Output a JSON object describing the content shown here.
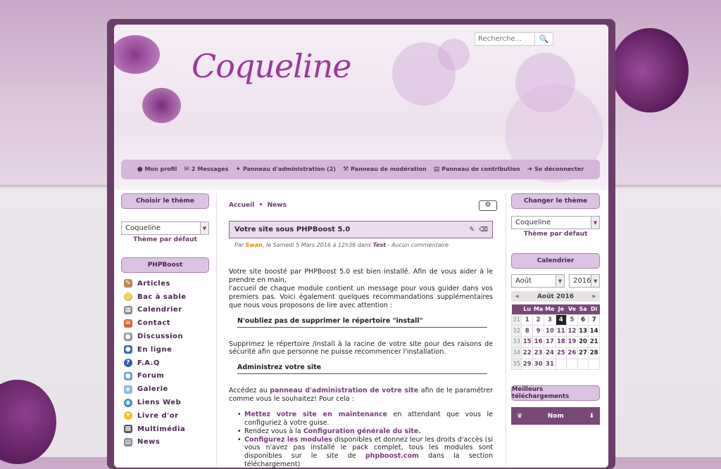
{
  "search": {
    "placeholder": "Recherche..."
  },
  "logo": "Coqueline",
  "menu": [
    {
      "icon": "user-icon",
      "label": "Mon profil"
    },
    {
      "icon": "envelope-icon",
      "label": "2 Messages"
    },
    {
      "icon": "wrench-icon",
      "label": "Panneau d'administration (2)"
    },
    {
      "icon": "gavel-icon",
      "label": "Panneau de modération"
    },
    {
      "icon": "file-icon",
      "label": "Panneau de contribution"
    },
    {
      "icon": "sign-out-icon",
      "label": "Se déconnecter"
    }
  ],
  "left": {
    "theme_title": "Choisir le thème",
    "theme_value": "Coqueline",
    "theme_default": "Thème par défaut",
    "menu_title": "PHPBoost",
    "modules": [
      "Articles",
      "Bac à sable",
      "Calendrier",
      "Contact",
      "Discussion",
      "En ligne",
      "F.A.Q",
      "Forum",
      "Galerie",
      "Liens Web",
      "Livre d'or",
      "Multimédia",
      "News"
    ]
  },
  "main": {
    "breadcrumb": [
      "Accueil",
      "News"
    ],
    "title": "Votre site sous PHPBoost 5.0",
    "byline": {
      "par": "Par",
      "user": "Swan",
      "date": ", le Samedi 5 Mars 2016 à 12h36 dans",
      "cat": "Test",
      "comments": "- Aucun commentaire"
    },
    "p1": "Votre site boosté par PHPBoost 5.0 est bien installé. Afin de vous aider à le prendre en main,",
    "p1b": "l'accueil de chaque module contient un message pour vous guider dans vos premiers pas. Voici également quelques recommandations supplémentaires que nous vous proposons de lire avec attention :",
    "h1": "N'oubliez pas de supprimer le répertoire \"install\"",
    "p2": "Supprimez le répertoire /install à la racine de votre site pour des raisons de sécurité afin que personne ne puisse recommencer l'installation.",
    "h2": "Administrez votre site",
    "p3a": "Accédez au",
    "p3link": "panneau d'administration de votre site",
    "p3b": "afin de le paramétrer comme vous le souhaitez! Pour cela :",
    "b1link": "Mettez votre site en maintenance",
    "b1": "en attendant que vous le configuriez à votre guise.",
    "b2a": "Rendez vous à la",
    "b2link": "Configuration générale du site.",
    "b3link": "Configurez les modules",
    "b3": "disponibles et donnez leur les droits d'accès (si vous n'avez pas installé le pack complet, tous les modules sont disponibles sur le site de",
    "b3link2": "phpboost.com",
    "b3c": "dans la section téléchargement)"
  },
  "right": {
    "theme_title": "Changer le thème",
    "theme_value": "Coqueline",
    "theme_default": "Thème par défaut",
    "cal_title": "Calendrier",
    "month": "Août",
    "year": "2016",
    "cal_label": "Août 2016",
    "days": [
      "Lu",
      "Ma",
      "Me",
      "Je",
      "Ve",
      "Sa",
      "Di"
    ],
    "weeks": [
      [
        "31",
        "1",
        "2",
        "3",
        "4",
        "5",
        "6",
        "7"
      ],
      [
        "32",
        "8",
        "9",
        "10",
        "11",
        "12",
        "13",
        "14"
      ],
      [
        "33",
        "15",
        "16",
        "17",
        "18",
        "19",
        "20",
        "21"
      ],
      [
        "34",
        "22",
        "23",
        "24",
        "25",
        "26",
        "27",
        "28"
      ],
      [
        "35",
        "29",
        "30",
        "31",
        "",
        "",
        "",
        ""
      ]
    ],
    "today": "4",
    "dl_title": "Meilleurs téléchargements",
    "dl_col": "Nom"
  }
}
